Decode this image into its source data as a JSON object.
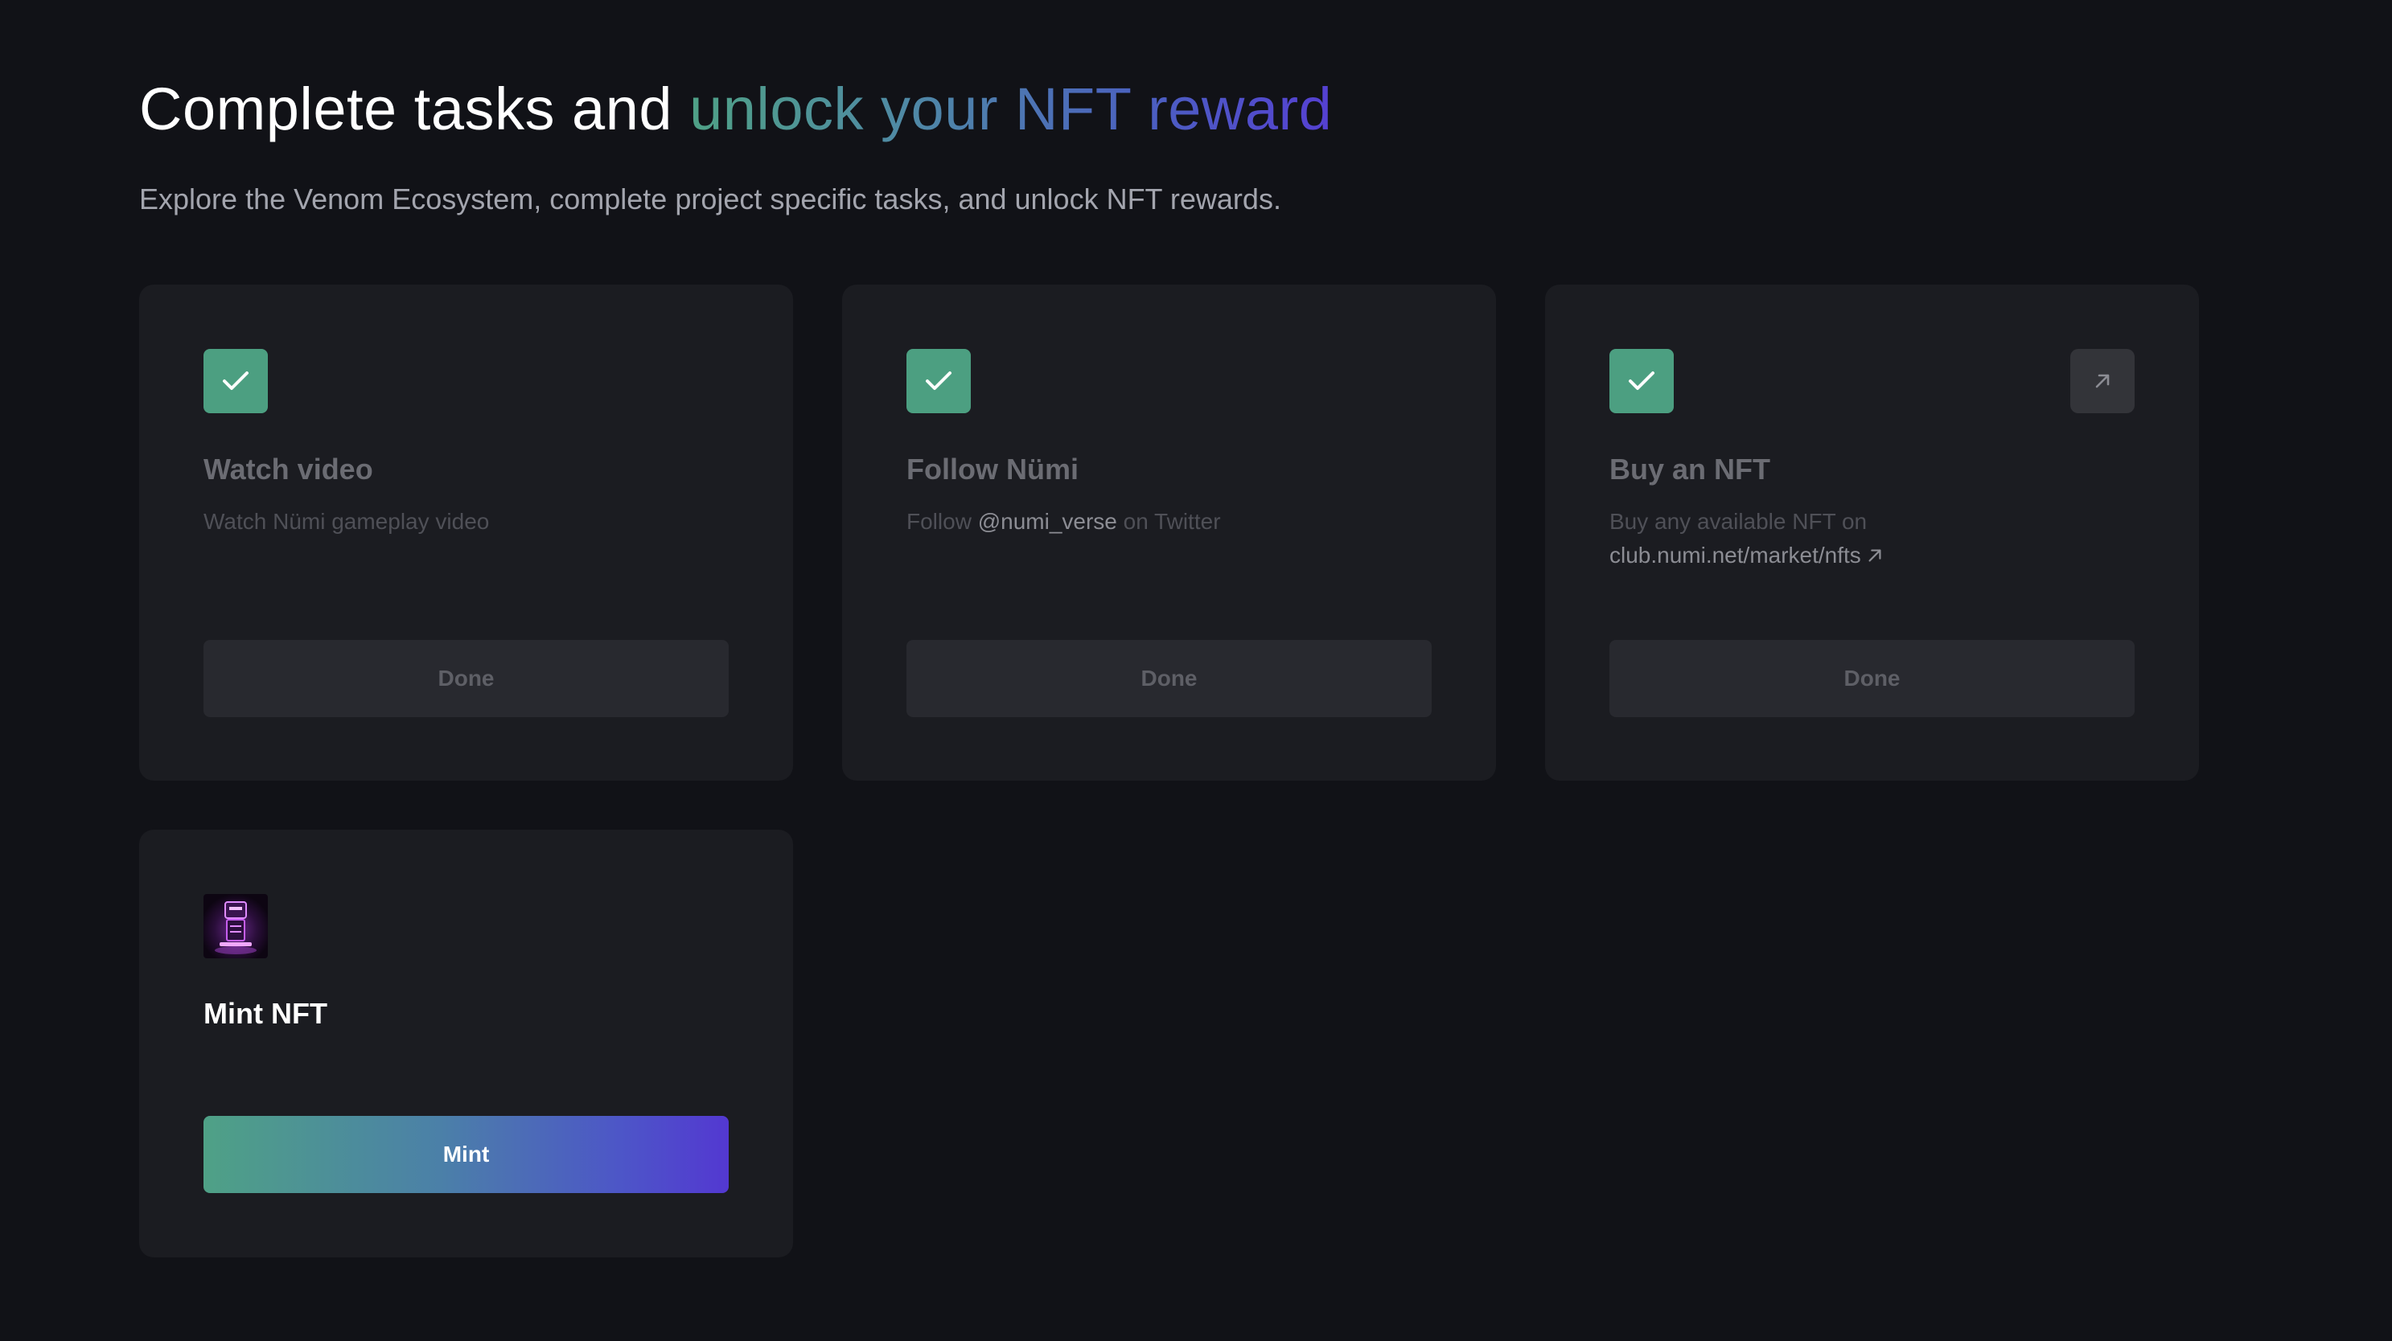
{
  "header": {
    "title_plain": "Complete tasks and",
    "title_highlight": "unlock your NFT reward",
    "subtitle": "Explore the Venom Ecosystem, complete project specific tasks, and unlock NFT rewards."
  },
  "colors": {
    "background": "#111217",
    "card": "#1B1C21",
    "success": "#4C9F81",
    "gradient_start": "#4FA186",
    "gradient_end": "#5338D1"
  },
  "tasks": [
    {
      "title": "Watch video",
      "description": "Watch Nümi gameplay video",
      "status_icon": "check-icon",
      "button_label": "Done"
    },
    {
      "title": "Follow Nümi",
      "description_prefix": "Follow",
      "description_handle": "@numi_verse",
      "description_suffix": "on Twitter",
      "status_icon": "check-icon",
      "button_label": "Done"
    },
    {
      "title": "Buy an NFT",
      "description_line1": "Buy any available NFT on",
      "description_link": "club.numi.net/market/nfts",
      "status_icon": "check-icon",
      "action_icon": "external-link-icon",
      "button_label": "Done"
    }
  ],
  "mint": {
    "title": "Mint NFT",
    "thumbnail_icon": "nft-robot-thumbnail",
    "button_label": "Mint"
  }
}
